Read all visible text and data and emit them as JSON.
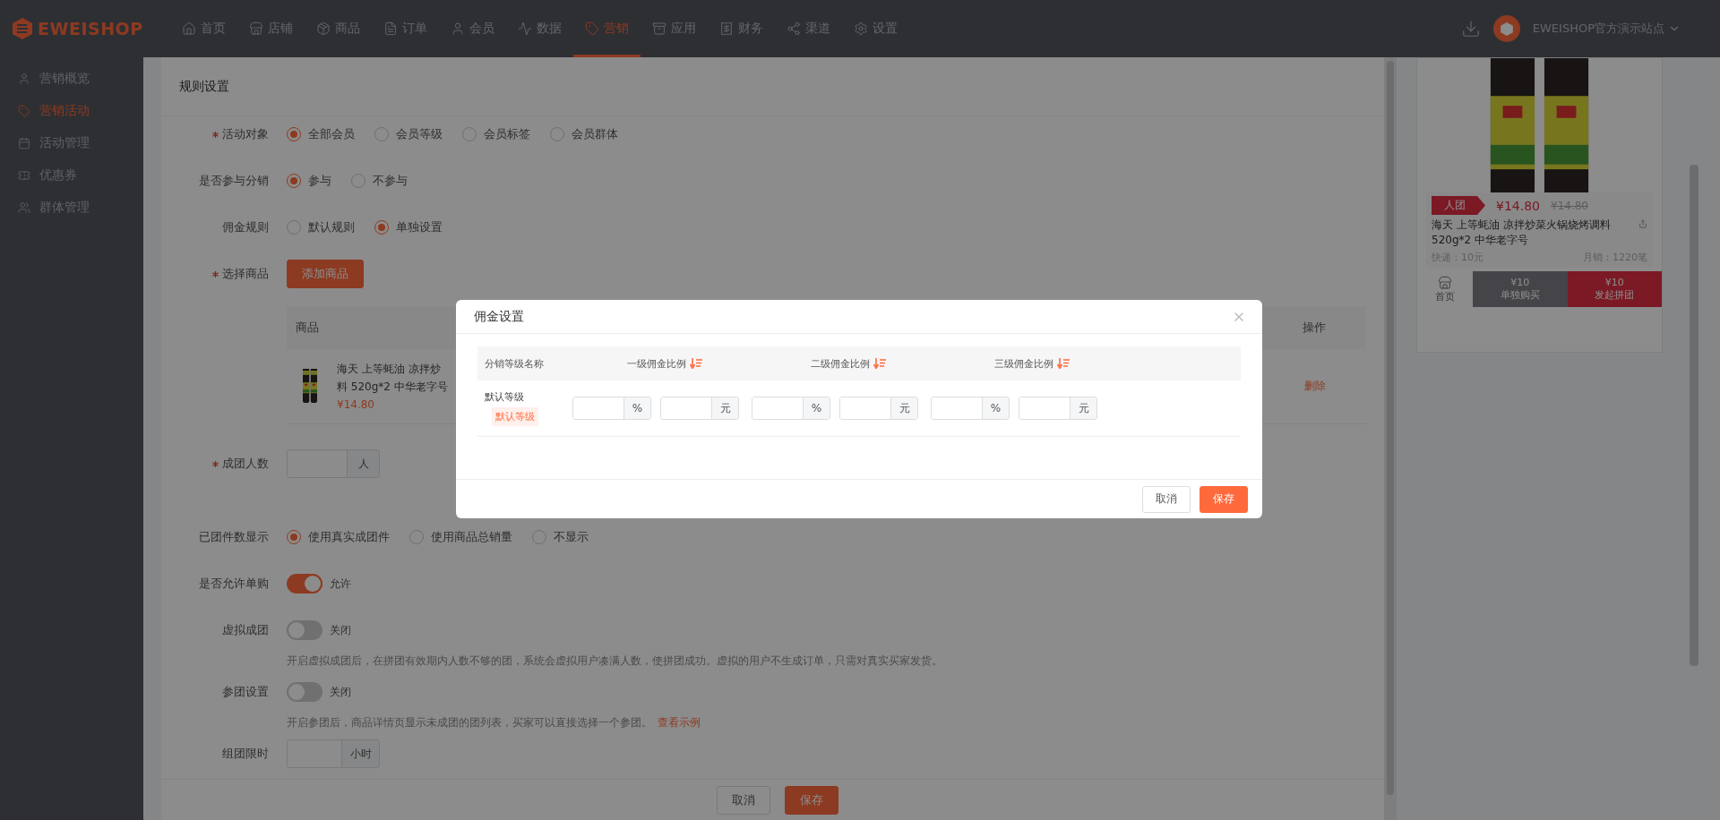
{
  "brand": "EWEISHOP",
  "nav": [
    {
      "label": "首页",
      "selected": false
    },
    {
      "label": "店铺",
      "selected": false
    },
    {
      "label": "商品",
      "selected": false
    },
    {
      "label": "订单",
      "selected": false
    },
    {
      "label": "会员",
      "selected": false
    },
    {
      "label": "数据",
      "selected": false
    },
    {
      "label": "营销",
      "selected": true
    },
    {
      "label": "应用",
      "selected": false
    },
    {
      "label": "财务",
      "selected": false
    },
    {
      "label": "渠道",
      "selected": false
    },
    {
      "label": "设置",
      "selected": false
    }
  ],
  "user": {
    "name": "EWEISHOP官方演示站点"
  },
  "sidebar": [
    {
      "label": "营销概览",
      "selected": false
    },
    {
      "label": "营销活动",
      "selected": true
    },
    {
      "label": "活动管理",
      "selected": false
    },
    {
      "label": "优惠券",
      "selected": false
    },
    {
      "label": "群体管理",
      "selected": false
    }
  ],
  "form": {
    "title": "规则设置",
    "rows": [
      {
        "kind": "radio",
        "label": "活动对象",
        "required": true,
        "options": [
          {
            "label": "全部会员",
            "selected": true
          },
          {
            "label": "会员等级",
            "selected": false
          },
          {
            "label": "会员标签",
            "selected": false
          },
          {
            "label": "会员群体",
            "selected": false
          }
        ]
      },
      {
        "kind": "radio",
        "label": "是否参与分销",
        "required": false,
        "options": [
          {
            "label": "参与",
            "selected": true
          },
          {
            "label": "不参与",
            "selected": false
          }
        ]
      },
      {
        "kind": "radio",
        "label": "佣金规则",
        "required": false,
        "options": [
          {
            "label": "默认规则",
            "selected": false
          },
          {
            "label": "单独设置",
            "selected": true
          }
        ]
      },
      {
        "kind": "button",
        "label": "选择商品",
        "required": true,
        "button": "添加商品"
      },
      {
        "kind": "table",
        "columns": [
          "商品",
          "操作"
        ],
        "rows": [
          {
            "name_lines": [
              "海天 上等蚝油 凉拌炒",
              "料 520g*2 中华老字号"
            ],
            "price": "¥14.80",
            "action": "删除"
          }
        ]
      },
      {
        "kind": "input",
        "label": "成团人数",
        "required": true,
        "suffix": "人"
      },
      {
        "kind": "radio",
        "label": "已团件数显示",
        "required": false,
        "options": [
          {
            "label": "使用真实成团件",
            "selected": true
          },
          {
            "label": "使用商品总销量",
            "selected": false
          },
          {
            "label": "不显示",
            "selected": false
          }
        ]
      },
      {
        "kind": "switch",
        "label": "是否允许单购",
        "required": false,
        "on": true,
        "state_label": "允许"
      },
      {
        "kind": "switch",
        "label": "虚拟成团",
        "required": false,
        "on": false,
        "state_label": "关闭",
        "help": "开启虚拟成团后，在拼团有效期内人数不够的团，系统会虚拟用户凑满人数，使拼团成功。虚拟的用户不生成订单，只需对真实买家发货。"
      },
      {
        "kind": "switch",
        "label": "参团设置",
        "required": false,
        "on": false,
        "state_label": "关闭",
        "help": "开启参团后，商品详情页显示未成团的团列表，买家可以直接选择一个参团。",
        "link": "查看示例"
      },
      {
        "kind": "input",
        "label": "组团限时",
        "required": false,
        "suffix": "小时"
      }
    ],
    "buttons": [
      {
        "label": "取消",
        "primary": false
      },
      {
        "label": "保存",
        "primary": true
      }
    ]
  },
  "preview": {
    "tag": "人团",
    "price": "¥14.80",
    "original_price": "¥14.80",
    "title": "海天 上等蚝油 凉拌炒菜火锅烧烤调料 520g*2 中华老字号",
    "shipping": "快递：10元",
    "sales": "月销：1220笔",
    "home": "首页",
    "actions": [
      {
        "price": "¥10",
        "label": "单独购买",
        "kind": "alone"
      },
      {
        "price": "¥10",
        "label": "发起拼团",
        "kind": "group"
      }
    ]
  },
  "modal": {
    "title": "佣金设置",
    "columns": [
      "分销等级名称",
      "一级佣金比例",
      "二级佣金比例",
      "三级佣金比例"
    ],
    "rows": [
      {
        "name": "默认等级",
        "tag": "默认等级",
        "inputs": [
          {
            "suffix": "%"
          },
          {
            "suffix": "元"
          },
          {
            "suffix": "%"
          },
          {
            "suffix": "元"
          },
          {
            "suffix": "%"
          },
          {
            "suffix": "元"
          }
        ]
      }
    ],
    "buttons": [
      {
        "label": "取消",
        "primary": false
      },
      {
        "label": "保存",
        "primary": true
      }
    ]
  }
}
